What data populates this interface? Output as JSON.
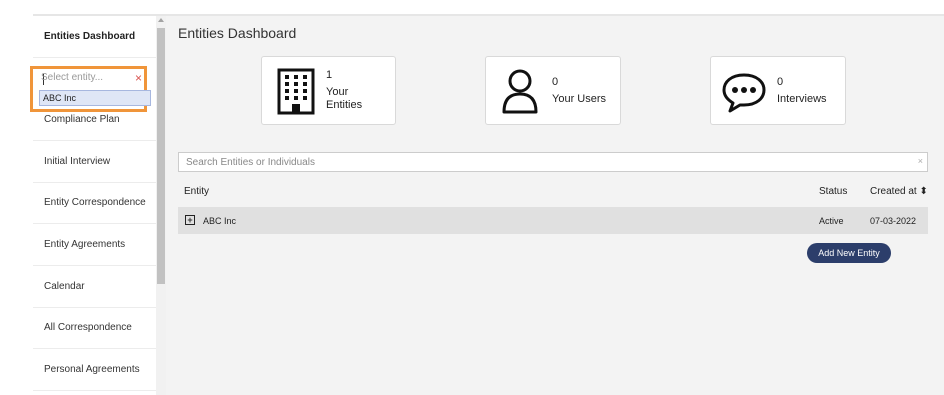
{
  "sidebar": {
    "items": [
      {
        "label": "Entities Dashboard"
      },
      {
        "label": ""
      },
      {
        "label": "Compliance Plan"
      },
      {
        "label": "Initial Interview"
      },
      {
        "label": "Entity Correspondence"
      },
      {
        "label": "Entity Agreements"
      },
      {
        "label": "Calendar"
      },
      {
        "label": "All Correspondence"
      },
      {
        "label": "Personal Agreements"
      }
    ]
  },
  "entity_select": {
    "placeholder": "Select entity...",
    "clear_icon": "×",
    "option": "ABC Inc"
  },
  "main": {
    "title": "Entities Dashboard",
    "cards": [
      {
        "icon": "building-icon",
        "count": "1",
        "label_line1": "Your",
        "label_line2": "Entities"
      },
      {
        "icon": "user-icon",
        "count": "0",
        "label_line1": "Your Users"
      },
      {
        "icon": "speech-bubble-icon",
        "count": "0",
        "label_line1": "Interviews"
      }
    ],
    "search": {
      "placeholder": "Search Entities or Individuals",
      "clear_icon": "×"
    },
    "table": {
      "headers": {
        "entity": "Entity",
        "status": "Status",
        "created": "Created at ⬍"
      },
      "rows": [
        {
          "expand": "+",
          "entity": "ABC Inc",
          "status": "Active",
          "created": "07-03-2022"
        }
      ]
    },
    "add_button": "Add New Entity"
  },
  "colors": {
    "accent": "#2c3e6b",
    "highlight": "#f0953a",
    "row": "#e0e0e0"
  }
}
